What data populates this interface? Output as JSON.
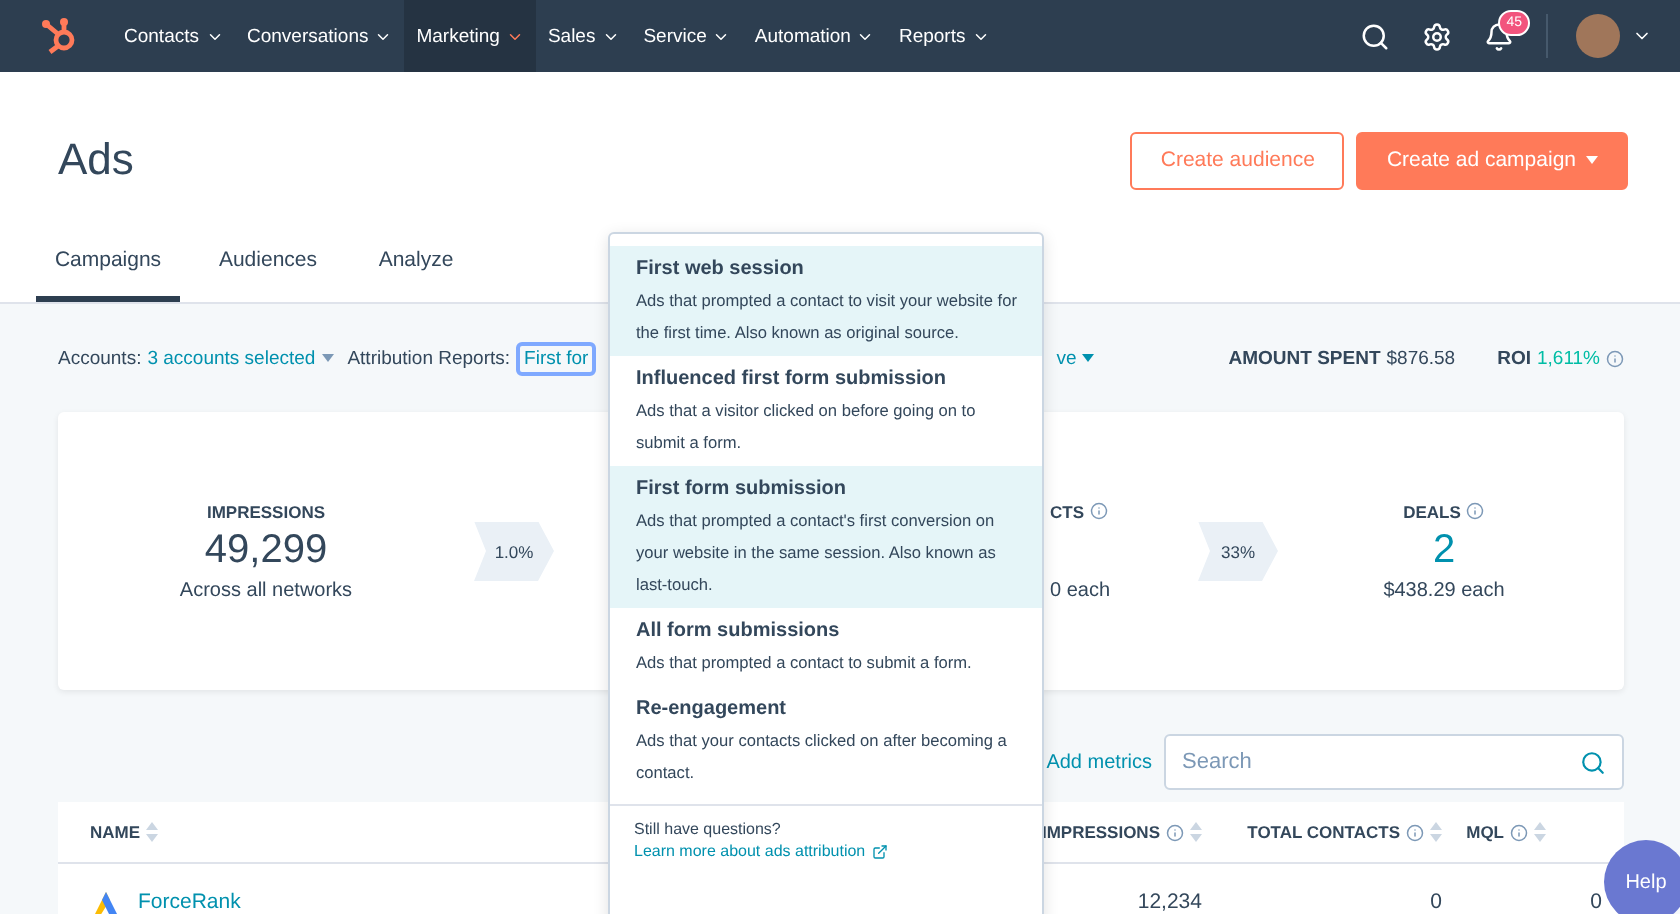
{
  "nav": {
    "items": [
      {
        "label": "Contacts",
        "selected": false
      },
      {
        "label": "Conversations",
        "selected": false
      },
      {
        "label": "Marketing",
        "selected": true
      },
      {
        "label": "Sales",
        "selected": false
      },
      {
        "label": "Service",
        "selected": false
      },
      {
        "label": "Automation",
        "selected": false
      },
      {
        "label": "Reports",
        "selected": false
      }
    ],
    "notification_count": "45"
  },
  "page": {
    "title": "Ads",
    "buttons": [
      {
        "label": "Create audience",
        "kind": "secondary"
      },
      {
        "label": "Create ad campaign",
        "kind": "primary"
      }
    ]
  },
  "tabs": [
    {
      "label": "Campaigns",
      "selected": true
    },
    {
      "label": "Audiences",
      "selected": false
    },
    {
      "label": "Analyze",
      "selected": false
    }
  ],
  "filters": {
    "accounts_label": "Accounts:",
    "accounts_value": "3 accounts selected",
    "attribution_label": "Attribution Reports:",
    "attribution_value": "First for",
    "hidden_value_tail": "ve",
    "amount_label": "AMOUNT SPENT",
    "amount_value": "$876.58",
    "roi_label": "ROI",
    "roi_value": "1,611%"
  },
  "funnel": {
    "impressions": {
      "label": "IMPRESSIONS",
      "value": "49,299",
      "sub": "Across all networks"
    },
    "rate_1": "1.0%",
    "contacts": {
      "label": "CTS",
      "value_tail": "0 each"
    },
    "rate_2": "33%",
    "deals": {
      "label": "DEALS",
      "value": "2",
      "sub": "$438.29 each"
    }
  },
  "toolbar": {
    "add_metrics": "Add metrics",
    "search_placeholder": "Search"
  },
  "table": {
    "columns": [
      "NAME",
      "IMPRESSIONS",
      "TOTAL CONTACTS",
      "MQL"
    ],
    "rows": [
      {
        "name": "ForceRank",
        "impressions": "12,234",
        "total_contacts": "0",
        "mql": "0"
      }
    ]
  },
  "dropdown": {
    "options": [
      {
        "title": "First web session",
        "description": "Ads that prompted a contact to visit your website for the first time. Also known as original source.",
        "highlighted": true
      },
      {
        "title": "Influenced first form submission",
        "description": "Ads that a visitor clicked on before going on to submit a form.",
        "highlighted": false
      },
      {
        "title": "First form submission",
        "description": "Ads that prompted a contact's first conversion on your website in the same session. Also known as last-touch.",
        "highlighted": true
      },
      {
        "title": "All form submissions",
        "description": "Ads that prompted a contact to submit a form.",
        "highlighted": false
      },
      {
        "title": "Re-engagement",
        "description": "Ads that your contacts clicked on after becoming a contact.",
        "highlighted": false
      }
    ],
    "footer_text": "Still have questions?",
    "footer_link": "Learn more about ads attribution"
  },
  "help": "Help"
}
